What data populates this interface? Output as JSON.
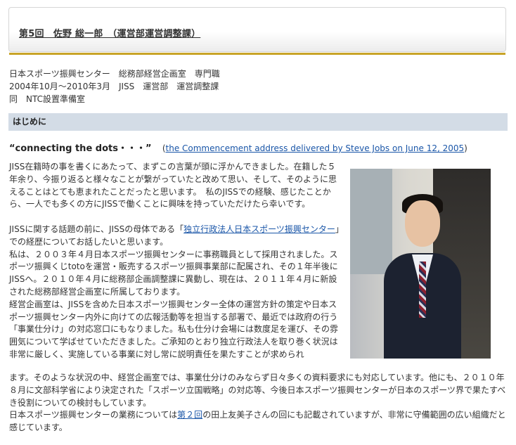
{
  "title": "第5回　佐野 総一郎　（運営部運営調整課）",
  "profile": [
    "日本スポーツ振興センター　総務部経営企画室　専門職",
    "2004年10月～2010年3月　JISS　運営部　運営調整課",
    "同　NTC設置準備室"
  ],
  "section_heading": "はじめに",
  "quote": {
    "text": "“connecting the dots・・・”",
    "link_open": "(",
    "link_text": "the Commencement address delivered by Steve Jobs on June 12, 2005",
    "link_close": ")"
  },
  "paragraph1": "JISS在籍時の事を書くにあたって、まずこの言葉が頭に浮かんできました。在籍した５年余り、今振り返ると様々なことが繋がっていたと改めて思い、そして、そのように思えることはとても恵まれたことだったと思います。　私のJISSでの経験、感じたことから、一人でも多くの方にJISSで働くことに興味を持っていただけたら幸いです。",
  "paragraph2": {
    "before": "JISSに関する話題の前に、JISSの母体である「",
    "link": "独立行政法人日本スポーツ振興センター",
    "after": "」での経歴についてお話したいと思います。"
  },
  "paragraph3": "私は、２００３年４月日本スポーツ振興センターに事務職員として採用されました。スポーツ振興くじtotoを運営・販売するスポーツ振興事業部に配属され、その１年半後にJISSへ。２０１０年４月に総務部企画調整課に異動し、現在は、２０１１年４月に新設された総務部経営企画室に所属しております。",
  "paragraph4": "経営企画室は、JISSを含めた日本スポーツ振興センター全体の運営方針の策定や日本スポーツ振興センター内外に向けての広報活動等を担当する部署で、最近では政府の行う「事業仕分け」の対応窓口にもなりました。私も仕分け会場には数度足を運び、その雰囲気について学ばせていただきました。ご承知のとおり独立行政法人を取り巻く状況は非常に厳しく、実施している事業に対し常に説明責任を果たすことが求められ",
  "paragraph4_cont": "ます。そのような状況の中、経営企画室では、事業仕分けのみならず日々多くの資料要求にも対応しています。他にも、２０１０年８月に文部科学省により決定された「スポーツ立国戦略」の対応等、今後日本スポーツ振興センターが日本のスポーツ界で果たすべき役割についての検討もしています。",
  "paragraph5": {
    "before": "日本スポーツ振興センターの業務については",
    "link": "第２回",
    "after": "の田上友美子さんの回にも記載されていますが、非常に守備範囲の広い組織だと感じています。"
  }
}
